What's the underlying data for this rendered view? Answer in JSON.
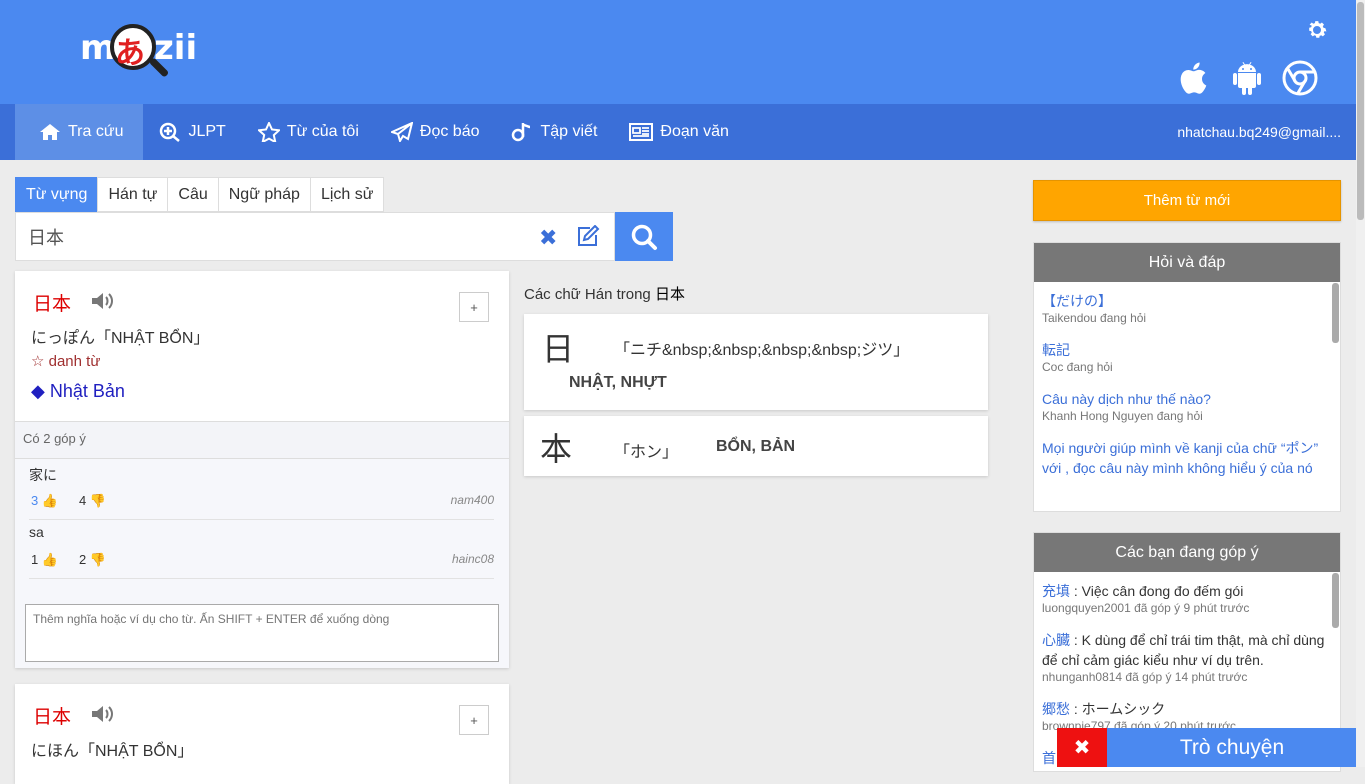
{
  "header": {
    "logo_left": "m",
    "logo_char": "あ",
    "logo_right": "zii"
  },
  "nav": {
    "items": [
      {
        "label": "Tra cứu",
        "icon": "home-icon"
      },
      {
        "label": "JLPT",
        "icon": "search-plus-icon"
      },
      {
        "label": "Từ của tôi",
        "icon": "star-icon"
      },
      {
        "label": "Đọc báo",
        "icon": "paper-plane-icon"
      },
      {
        "label": "Tập viết",
        "icon": "brush-icon"
      },
      {
        "label": "Đoạn văn",
        "icon": "newspaper-icon"
      }
    ],
    "user": "nhatchau.bq249@gmail...."
  },
  "search": {
    "tabs": [
      "Từ vựng",
      "Hán tự",
      "Câu",
      "Ngữ pháp",
      "Lịch sử"
    ],
    "active_tab": "Từ vựng",
    "value": "日本"
  },
  "word1": {
    "word": "日本",
    "reading": "にっぽん「NHẬT BỔN」",
    "type": "☆ danh từ",
    "meaning": "◆ Nhật Bản",
    "plus": "+",
    "gopy_count": "Có 2 góp ý",
    "gopy": [
      {
        "text": "家に",
        "up": "3",
        "down": "4",
        "user": "nam400"
      },
      {
        "text": "sa",
        "up": "1",
        "down": "2",
        "user": "hainc08"
      }
    ],
    "textarea_placeholder": "Thêm nghĩa hoặc ví dụ cho từ. Ấn SHIFT + ENTER để xuống dòng"
  },
  "word2": {
    "word": "日本",
    "reading": "にほん「NHẬT BỔN」",
    "plus": "+"
  },
  "kanji": {
    "title_prefix": "Các chữ Hán trong",
    "title_word": "日本",
    "items": [
      {
        "char": "日",
        "on": "「ニチ&nbsp;&nbsp;&nbsp;&nbsp;ジツ」",
        "han": "NHẬT, NHỰT"
      },
      {
        "char": "本",
        "on": "「ホン」",
        "han": "BỔN, BẢN"
      }
    ]
  },
  "sidebar": {
    "add_word": "Thêm từ mới",
    "qa_title": "Hỏi và đáp",
    "qa": [
      {
        "q": "【だけの】",
        "who": "Taikendou đang hỏi"
      },
      {
        "q": "転記",
        "who": "Coc đang hỏi"
      },
      {
        "q": "Câu này dịch như thế nào?",
        "who": "Khanh Hong Nguyen đang hỏi"
      },
      {
        "q": "Mọi người giúp mình về kanji của chữ “ポン” với , đọc câu này mình không hiểu ý của nó",
        "who": ""
      }
    ],
    "contrib_title": "Các bạn đang góp ý",
    "contrib": [
      {
        "word": "充填",
        "text": " : Việc cân đong đo đếm gói",
        "who": "luongquyen2001 đã góp ý 9 phút trước"
      },
      {
        "word": "心臓",
        "text": " : K dùng để chỉ trái tim thật, mà chỉ dùng để chỉ cảm giác kiểu như ví dụ trên.",
        "who": "nhunganh0814 đã góp ý 14 phút trước"
      },
      {
        "word": "郷愁",
        "text": " : ホームシック",
        "who": "brownpie797 đã góp ý 20 phút trước"
      },
      {
        "word": "首",
        "text": "",
        "who": ""
      }
    ]
  },
  "chat": {
    "close": "✖",
    "label": "Trò chuyện"
  },
  "colors": {
    "header": "#4b89f0",
    "nav": "#3b6fd8",
    "accent_orange": "#ffa500",
    "word_red": "#dd0000",
    "chat_close": "#ee1111"
  }
}
